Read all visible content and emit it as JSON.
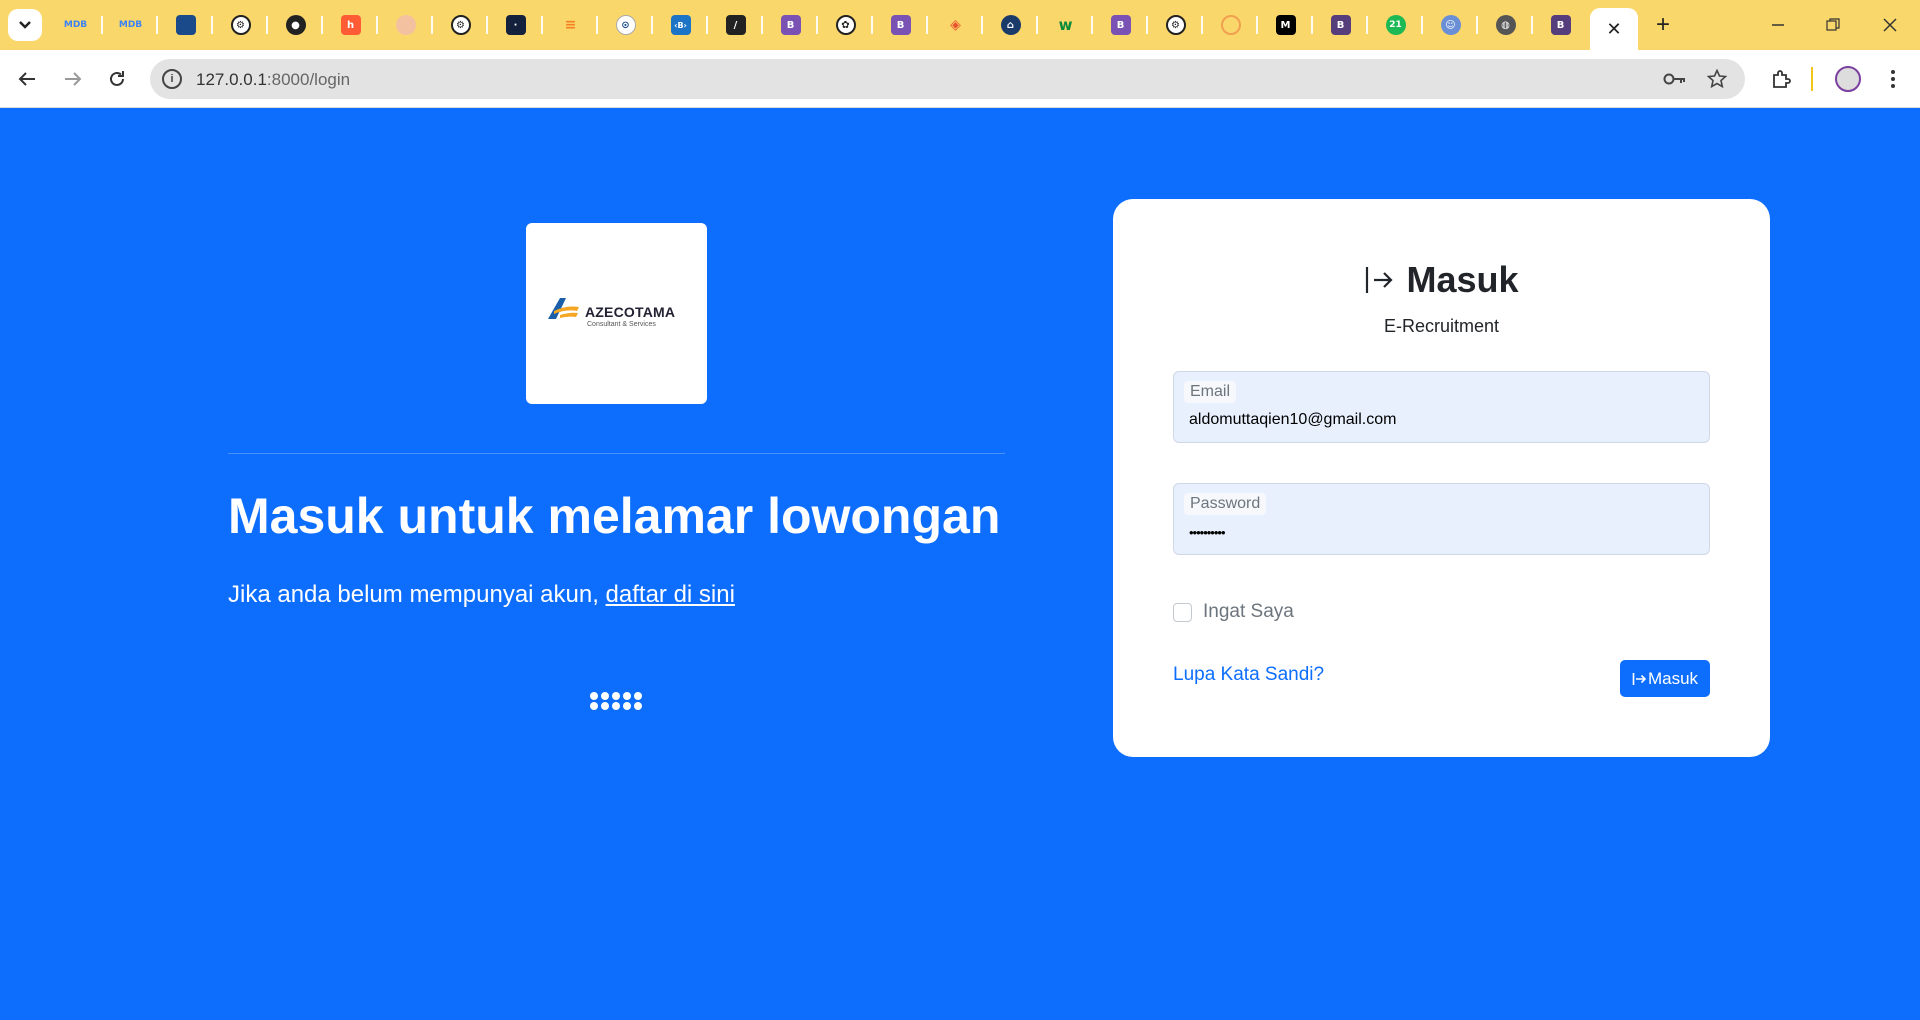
{
  "browser": {
    "tab_favicons": [
      "mdb-icon",
      "mdb-icon",
      "app-icon",
      "extension-icon",
      "github-icon",
      "hubspot-icon",
      "candy-icon",
      "extension-icon",
      "dark-app-icon",
      "stackoverflow-icon",
      "circle-app-icon",
      "bootstrap-blue-icon",
      "notion-icon",
      "bootstrap-icon",
      "openai-icon",
      "bootstrap-icon",
      "git-icon",
      "home-icon",
      "w-icon",
      "bootstrap-icon",
      "extension-icon",
      "swirl-icon",
      "medium-icon",
      "bootstrap-dark-icon",
      "badge-21-icon",
      "user-icon",
      "globe-icon",
      "bootstrap-dark-icon"
    ],
    "active_tab_close": "✕",
    "new_tab": "+",
    "url_host": "127.0.0.1",
    "url_rest": ":8000/login",
    "colors": {
      "tabstrip": "#fad76a",
      "page": "#0d6efd"
    }
  },
  "brand": {
    "name": "AZECOTAMA",
    "tagline": "Consultant & Services"
  },
  "hero": {
    "headline": "Masuk untuk melamar lowongan",
    "register_prefix": "Jika anda belum mempunyai akun,",
    "register_link": "daftar di sini"
  },
  "login": {
    "title": "Masuk",
    "subtitle": "E-Recruitment",
    "email_label": "Email",
    "email_value": "aldomuttaqien10@gmail.com",
    "password_label": "Password",
    "password_value": "••••••••••",
    "remember_label": "Ingat Saya",
    "forgot_link": "Lupa Kata Sandi?",
    "submit_label": "Masuk"
  }
}
